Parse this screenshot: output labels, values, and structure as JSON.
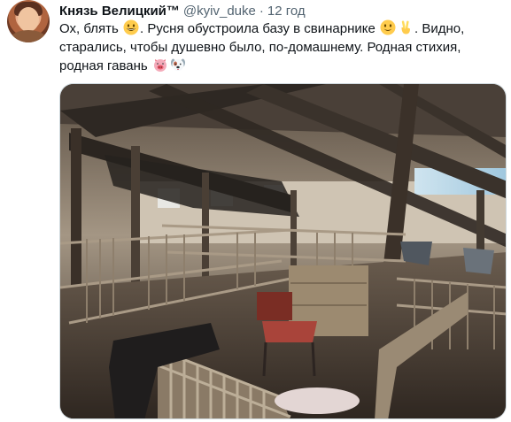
{
  "tweet": {
    "display_name": "Князь Велицкий™",
    "handle": "@kyiv_duke",
    "separator": "·",
    "time": "12 год",
    "text_parts": [
      "Ох, блять ",
      ". Русня обустроила базу в свинарнике ",
      ". Видно, старались, чтобы душевно было, по-домашнему. Родная стихия, родная гавань "
    ],
    "emojis": [
      "grinning-face-emoji",
      "slightly-smiling-face-emoji",
      "victory-hand-emoji",
      "pig-face-emoji",
      "dog-face-emoji"
    ]
  },
  "colors": {
    "text": "#0f1419",
    "secondary": "#536471",
    "media_border": "#cfd9de"
  }
}
